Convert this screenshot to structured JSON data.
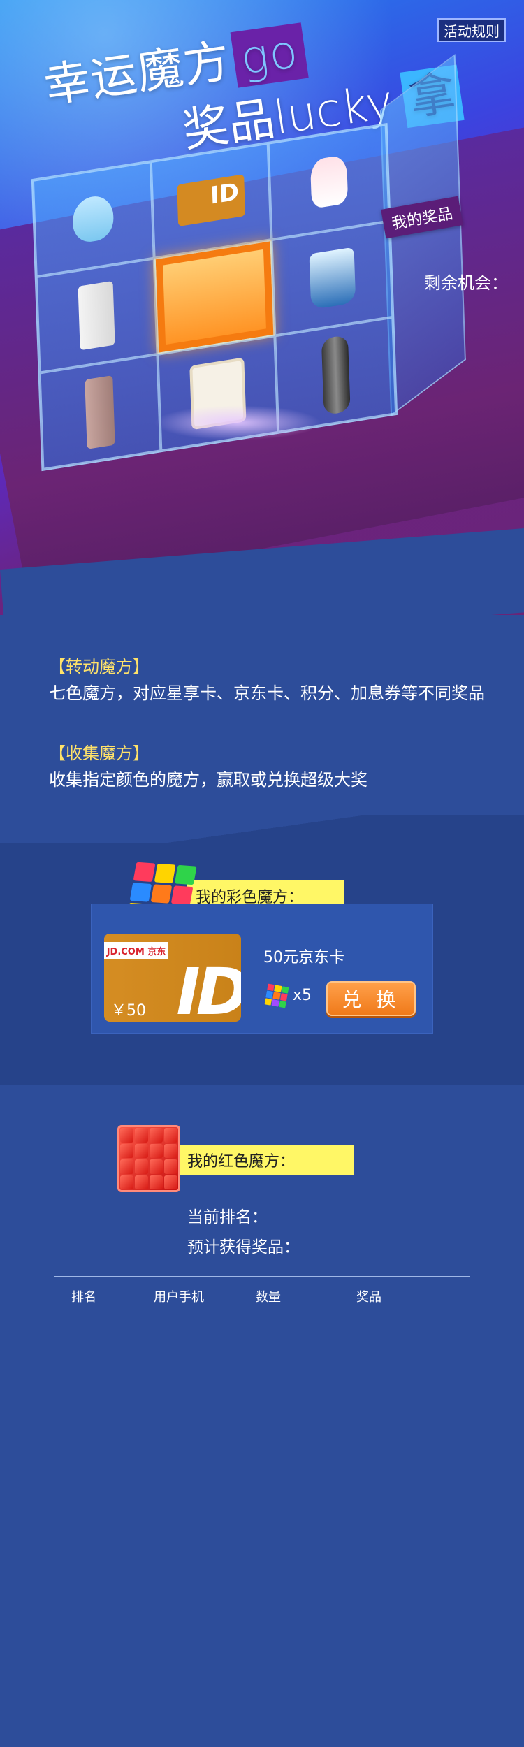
{
  "header": {
    "rules_label": "活动规则",
    "title_line1": "幸运魔方",
    "title_line1_tag": "go",
    "title_line2": "奖品lucky",
    "title_line2_tag": "拿"
  },
  "prizes": {
    "my_prize_label": "我的奖品",
    "remaining_label": "剩余机会：",
    "grid_icons": [
      "cleanser-icon",
      "jd-card-icon",
      "bear-icon",
      "router-icon",
      "lottery-center",
      "kettle-icon",
      "thermos-icon",
      "tablet-icon",
      "shaver-icon"
    ],
    "card_amount": "¥50"
  },
  "description": {
    "section1_title": "【转动魔方】",
    "section1_text": "七色魔方，对应星享卡、京东卡、积分、加息券等不同奖品",
    "section2_title": "【收集魔方】",
    "section2_text": "收集指定颜色的魔方，赢取或兑换超级大奖"
  },
  "color_cube": {
    "label": "我的彩色魔方：",
    "card_logo": "JD.COM 京东",
    "card_amount": "￥50",
    "prize_name": "50元京东卡",
    "quantity": "x5",
    "exchange_label": "兑 换"
  },
  "red_cube": {
    "label": "我的红色魔方：",
    "current_rank_label": "当前排名：",
    "expected_prize_label": "预计获得奖品：",
    "table_headers": [
      "排名",
      "用户手机",
      "数量",
      "奖品"
    ]
  },
  "colors": {
    "accent_yellow": "#fff766",
    "heading_yellow": "#ffe26a",
    "exchange_orange": "#f07a1a",
    "page_blue": "#2d4d9a"
  }
}
